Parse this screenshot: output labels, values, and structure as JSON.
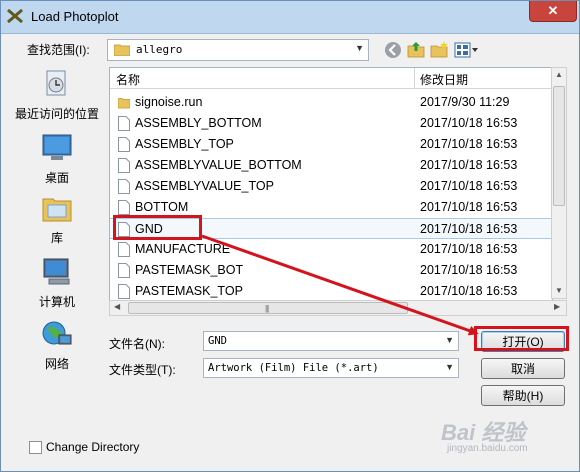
{
  "window": {
    "title": "Load Photoplot",
    "close_label": "✕"
  },
  "lookin": {
    "label": "查找范围(I):",
    "value": "allegro",
    "arrow": "▼"
  },
  "places": [
    {
      "label": "最近访问的位置",
      "icon": "recent-places-icon"
    },
    {
      "label": "桌面",
      "icon": "desktop-icon"
    },
    {
      "label": "库",
      "icon": "libraries-icon"
    },
    {
      "label": "计算机",
      "icon": "computer-icon"
    },
    {
      "label": "网络",
      "icon": "network-icon"
    }
  ],
  "filelist": {
    "col_name": "名称",
    "col_date": "修改日期",
    "rows": [
      {
        "name": "signoise.run",
        "date": "2017/9/30 11:29",
        "icon": "folder-icon"
      },
      {
        "name": "ASSEMBLY_BOTTOM",
        "date": "2017/10/18 16:53",
        "icon": "file-icon"
      },
      {
        "name": "ASSEMBLY_TOP",
        "date": "2017/10/18 16:53",
        "icon": "file-icon"
      },
      {
        "name": "ASSEMBLYVALUE_BOTTOM",
        "date": "2017/10/18 16:53",
        "icon": "file-icon"
      },
      {
        "name": "ASSEMBLYVALUE_TOP",
        "date": "2017/10/18 16:53",
        "icon": "file-icon"
      },
      {
        "name": "BOTTOM",
        "date": "2017/10/18 16:53",
        "icon": "file-icon"
      },
      {
        "name": "GND",
        "date": "2017/10/18 16:53",
        "icon": "file-icon",
        "selected": true
      },
      {
        "name": "MANUFACTURE",
        "date": "2017/10/18 16:53",
        "icon": "file-icon"
      },
      {
        "name": "PASTEMASK_BOT",
        "date": "2017/10/18 16:53",
        "icon": "file-icon"
      },
      {
        "name": "PASTEMASK_TOP",
        "date": "2017/10/18 16:53",
        "icon": "file-icon"
      }
    ]
  },
  "filename": {
    "label": "文件名(N):",
    "value": "GND"
  },
  "filetype": {
    "label": "文件类型(T):",
    "value": "Artwork (Film) File (*.art)"
  },
  "buttons": {
    "open": "打开(O)",
    "cancel": "取消",
    "help": "帮助(H)"
  },
  "change_directory": {
    "label": "Change Directory",
    "checked": false
  },
  "watermark": {
    "main": "Bai 经验",
    "sub": "jingyan.baidu.com"
  },
  "colors": {
    "annotation": "#d4141c",
    "selection_border": "#a8c8ec"
  }
}
